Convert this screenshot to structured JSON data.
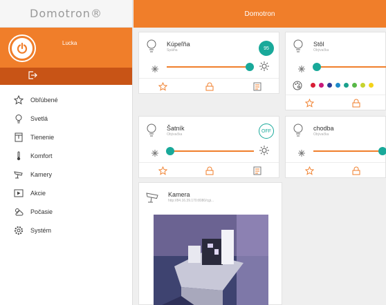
{
  "app": {
    "logo": "Domotron®",
    "title": "Domotron"
  },
  "user": {
    "name": "Lucka"
  },
  "menu": [
    {
      "label": "Obľúbené",
      "icon": "star-icon"
    },
    {
      "label": "Svetlá",
      "icon": "bulb-icon"
    },
    {
      "label": "Tienenie",
      "icon": "blind-icon"
    },
    {
      "label": "Komfort",
      "icon": "thermometer-icon"
    },
    {
      "label": "Kamery",
      "icon": "camera-icon"
    },
    {
      "label": "Akcie",
      "icon": "play-icon"
    },
    {
      "label": "Počasie",
      "icon": "weather-icon"
    },
    {
      "label": "Systém",
      "icon": "gear-icon"
    }
  ],
  "devices": [
    {
      "name": "Kúpeľňa",
      "room": "Spálňa",
      "value": "95",
      "level": 0.95
    },
    {
      "name": "Stôl",
      "room": "Obývačka",
      "level": 0.0
    },
    {
      "name": "Šatník",
      "room": "Obývačka",
      "value": "OFF",
      "level": 0.0
    },
    {
      "name": "chodba",
      "room": "Obývačka",
      "level": 1.0
    }
  ],
  "camera": {
    "name": "Kamera",
    "url": "http://84.16.39.170:8080/cgi..."
  },
  "colors": {
    "accent": "#f07e2a",
    "dark_accent": "#c85416",
    "teal": "#19a99a"
  },
  "palette": [
    "#d81e35",
    "#c8187a",
    "#2a3c96",
    "#1e8acb",
    "#1aa18c",
    "#58b847",
    "#c6d32e",
    "#f4d31a"
  ]
}
